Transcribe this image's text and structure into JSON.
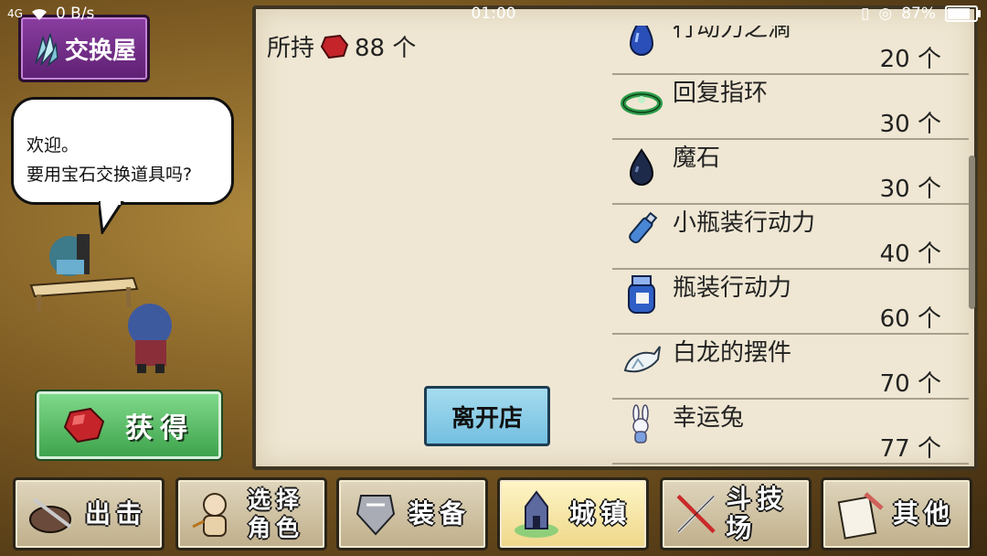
{
  "status_bar": {
    "network": "4G",
    "speed": "0 B/s",
    "time": "01:00",
    "battery": "87%",
    "battery_level": 0.87
  },
  "header": {
    "title": "交换屋",
    "icon": "crystal-icon"
  },
  "speech": {
    "line1": "欢迎。",
    "line2": "要用宝石交换道具吗?"
  },
  "acquire_button": {
    "label": "获得",
    "icon": "ruby-icon"
  },
  "shop": {
    "owned_label": "所持",
    "owned_count": "88 个",
    "leave_button": "离开店",
    "items": [
      {
        "name": "行动力之滴",
        "cost": "20 个",
        "icon": "blue-drop-icon"
      },
      {
        "name": "回复指环",
        "cost": "30 个",
        "icon": "green-ring-icon"
      },
      {
        "name": "魔石",
        "cost": "30 个",
        "icon": "dark-stone-icon"
      },
      {
        "name": "小瓶装行动力",
        "cost": "40 个",
        "icon": "small-bottle-icon"
      },
      {
        "name": "瓶装行动力",
        "cost": "60 个",
        "icon": "jar-icon"
      },
      {
        "name": "白龙的摆件",
        "cost": "70 个",
        "icon": "white-dragon-icon"
      },
      {
        "name": "幸运兔",
        "cost": "77 个",
        "icon": "lucky-rabbit-icon"
      }
    ]
  },
  "nav": [
    {
      "label": "出击",
      "icon": "sortie-icon",
      "active": false
    },
    {
      "label": "选择角色",
      "icon": "character-icon",
      "active": false
    },
    {
      "label": "装备",
      "icon": "equipment-icon",
      "active": false
    },
    {
      "label": "城镇",
      "icon": "town-icon",
      "active": true
    },
    {
      "label": "斗技场",
      "icon": "arena-icon",
      "active": false
    },
    {
      "label": "其他",
      "icon": "other-icon",
      "active": false
    }
  ],
  "colors": {
    "panel_bg": "#efe7d3",
    "header_purple": "#7a2e8e",
    "acquire_green": "#4fb85c",
    "leave_blue": "#8ccfe8",
    "active_nav": "#f4e3a3"
  }
}
